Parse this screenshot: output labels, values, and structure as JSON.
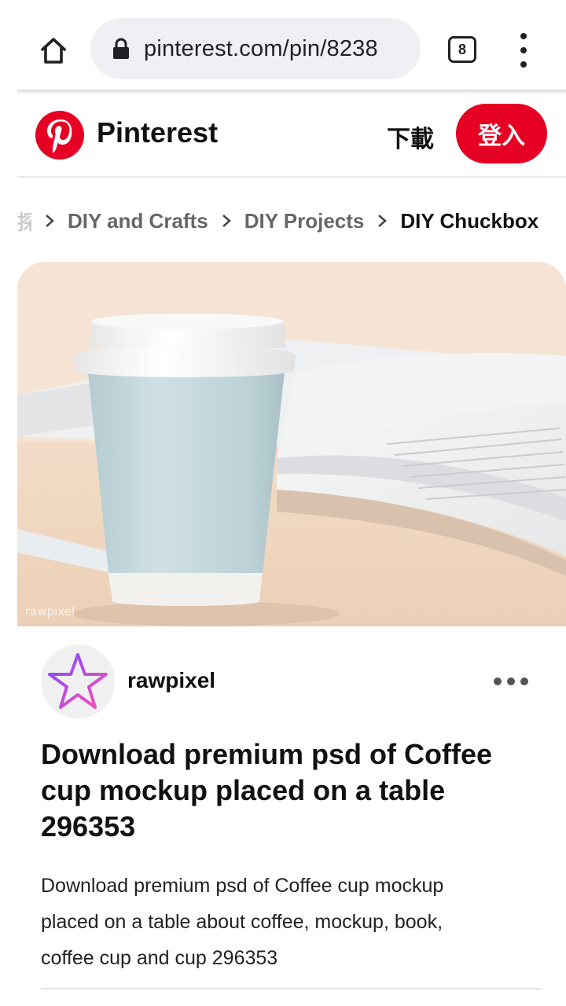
{
  "browser": {
    "url": "pinterest.com/pin/8238",
    "tab_count": "8"
  },
  "header": {
    "brand": "Pinterest",
    "download_label": "下載",
    "login_label": "登入",
    "brand_color": "#e60023"
  },
  "breadcrumb": {
    "items": [
      "DIY and Crafts",
      "DIY Projects",
      "DIY Chuckbox"
    ]
  },
  "pin": {
    "watermark": "rawpixel",
    "author": "rawpixel",
    "title": "Download premium psd of Coffee cup mockup placed on a table 296353",
    "description": "Download premium psd of Coffee cup mockup placed on a table about coffee, mockup, book, coffee cup and cup 296353"
  }
}
